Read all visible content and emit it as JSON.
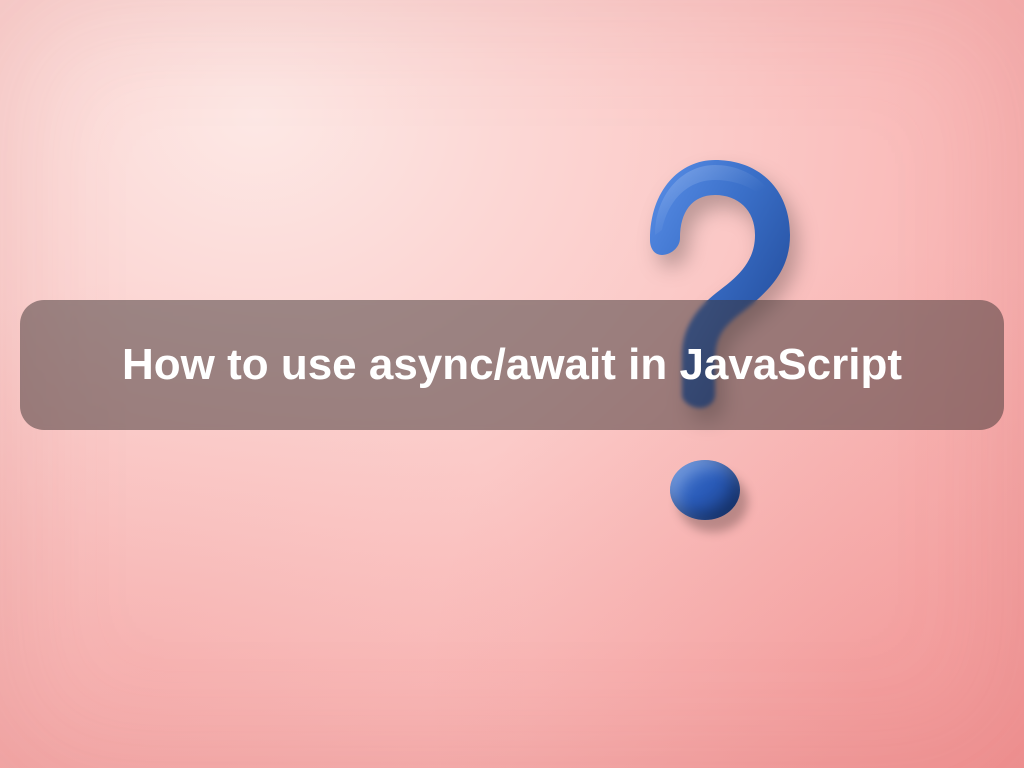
{
  "title": "How to use async/await in JavaScript"
}
